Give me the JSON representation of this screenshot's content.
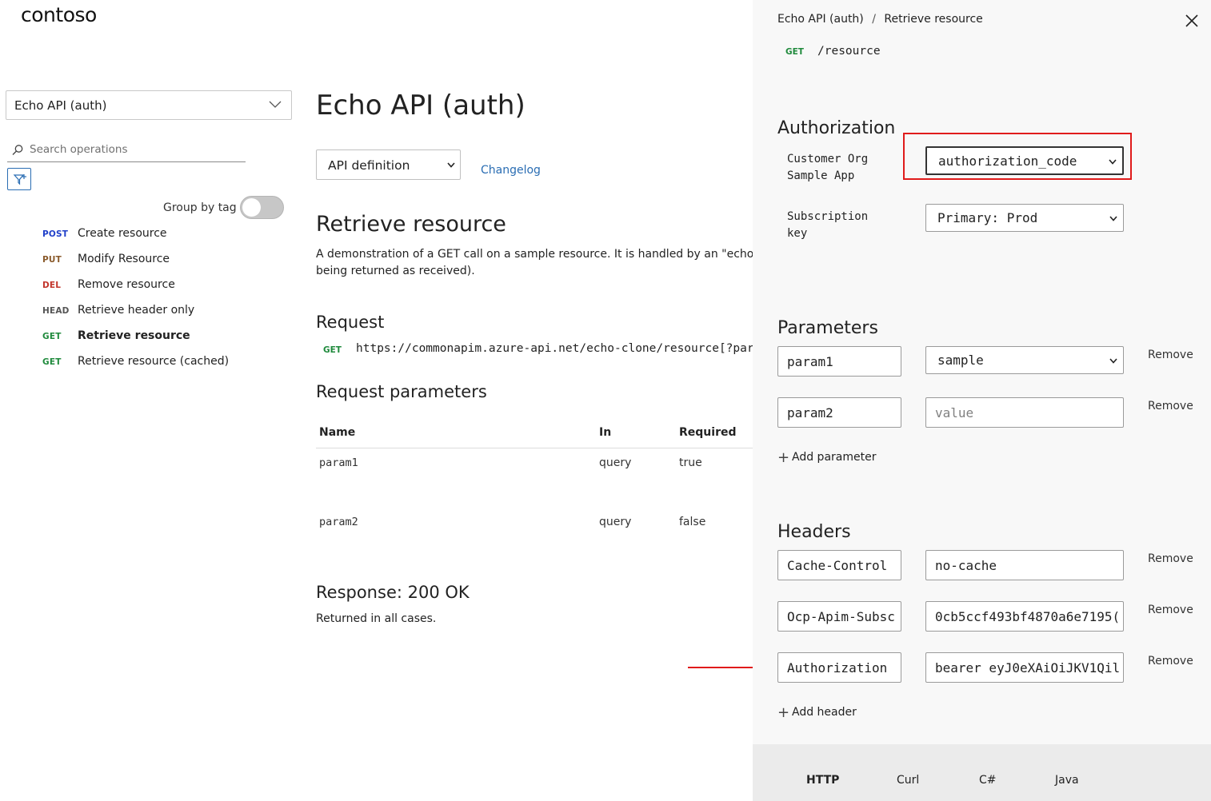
{
  "brand": {
    "logo": "contoso"
  },
  "sidebar": {
    "api_select": "Echo API (auth)",
    "search_placeholder": "Search operations",
    "group_by_tag_label": "Group by tag",
    "operations": [
      {
        "method": "POST",
        "name": "Create resource",
        "color": "#1f3fc9"
      },
      {
        "method": "PUT",
        "name": "Modify Resource",
        "color": "#8a5a2b"
      },
      {
        "method": "DEL",
        "name": "Remove resource",
        "color": "#c2352b"
      },
      {
        "method": "HEAD",
        "name": "Retrieve header only",
        "color": "#555555"
      },
      {
        "method": "GET",
        "name": "Retrieve resource",
        "color": "#1f8a3c",
        "active": true
      },
      {
        "method": "GET",
        "name": "Retrieve resource (cached)",
        "color": "#1f8a3c"
      }
    ]
  },
  "main": {
    "title": "Echo API (auth)",
    "definition_select": "API definition",
    "changelog_link": "Changelog",
    "operation_title": "Retrieve resource",
    "description_line1": "A demonstration of a GET call on a sample resource. It is handled by an \"echo\" backe",
    "description_line2": "being returned as received).",
    "request_heading": "Request",
    "request_method": "GET",
    "request_url": "https://commonapim.azure-api.net/echo-clone/resource[?param",
    "params_heading": "Request parameters",
    "table_headers": {
      "name": "Name",
      "in": "In",
      "required": "Required"
    },
    "params": [
      {
        "name": "param1",
        "in": "query",
        "required": "true"
      },
      {
        "name": "param2",
        "in": "query",
        "required": "false"
      }
    ],
    "response_heading": "Response: 200 OK",
    "response_text": "Returned in all cases."
  },
  "panel": {
    "breadcrumb_api": "Echo API (auth)",
    "breadcrumb_sep": "/",
    "breadcrumb_op": "Retrieve resource",
    "method": "GET",
    "path": "/resource",
    "authorization_heading": "Authorization",
    "auth_label_line1": "Customer Org",
    "auth_label_line2": "Sample App",
    "auth_flow": "authorization_code",
    "subscription_label_line1": "Subscription",
    "subscription_label_line2": "key",
    "subscription_value": "Primary: Prod",
    "parameters_heading": "Parameters",
    "parameters": [
      {
        "name": "param1",
        "value": "sample",
        "value_is_select": true
      },
      {
        "name": "param2",
        "value_placeholder": "value"
      }
    ],
    "remove_label": "Remove",
    "add_parameter": "Add parameter",
    "headers_heading": "Headers",
    "headers": [
      {
        "name": "Cache-Control",
        "value": "no-cache"
      },
      {
        "name": "Ocp-Apim-Subsc",
        "value": "0cb5ccf493bf4870a6e7195("
      },
      {
        "name": "Authorization",
        "value": "bearer eyJ0eXAiOiJKV1Qil"
      }
    ],
    "add_header": "Add header",
    "code_tabs": [
      "HTTP",
      "Curl",
      "C#",
      "Java"
    ],
    "active_code_tab": "HTTP"
  },
  "annotations": {
    "highlight_color": "#e01b1b"
  }
}
